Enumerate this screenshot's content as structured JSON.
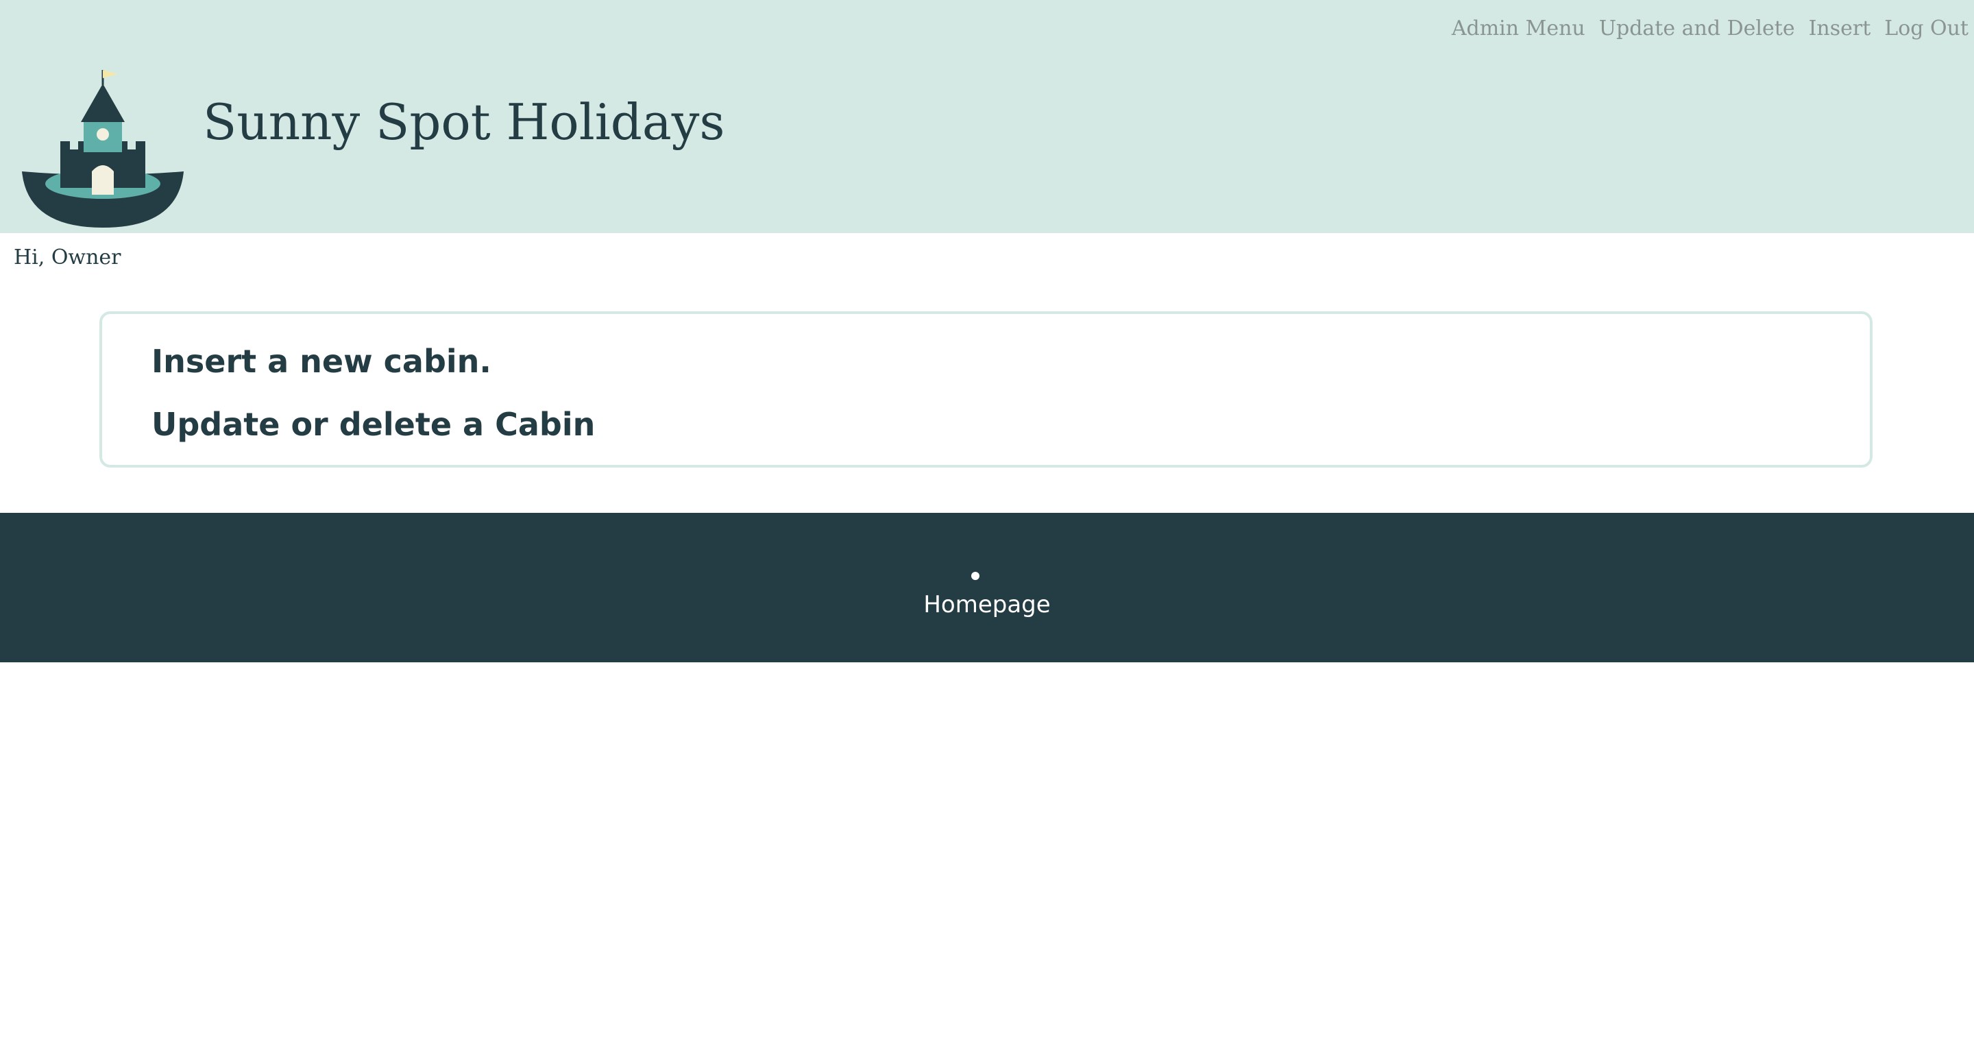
{
  "header": {
    "site_title": "Sunny Spot Holidays",
    "logo_icon": "castle-logo-icon",
    "nav": [
      {
        "label": "Admin Menu"
      },
      {
        "label": "Update and Delete"
      },
      {
        "label": "Insert"
      },
      {
        "label": "Log Out"
      }
    ]
  },
  "greeting": "Hi, Owner",
  "admin_panel": {
    "insert_label": "Insert a new cabin.",
    "update_label": "Update or delete a Cabin"
  },
  "footer": {
    "links": [
      {
        "label": "Homepage"
      }
    ]
  },
  "colors": {
    "header_bg": "#d5e9e4",
    "primary_dark": "#243c43",
    "accent_teal": "#5fb0a8",
    "nav_text": "#8a9592"
  }
}
